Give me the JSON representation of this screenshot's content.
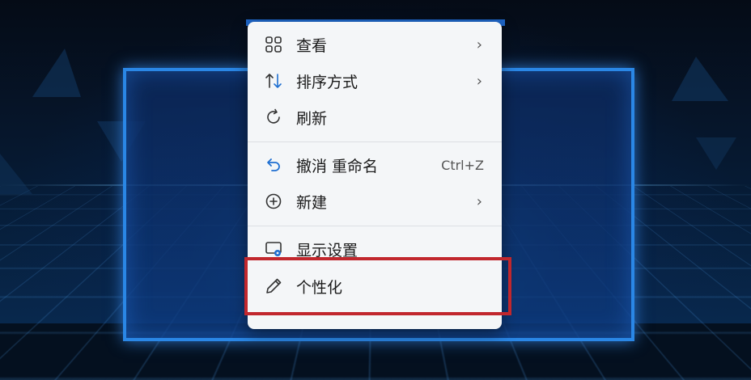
{
  "context_menu": {
    "items": [
      {
        "label": "查看",
        "icon": "grid-view-icon",
        "has_submenu": true
      },
      {
        "label": "排序方式",
        "icon": "sort-icon",
        "has_submenu": true
      },
      {
        "label": "刷新",
        "icon": "refresh-icon",
        "has_submenu": false
      },
      {
        "label": "撤消 重命名",
        "icon": "undo-icon",
        "shortcut": "Ctrl+Z"
      },
      {
        "label": "新建",
        "icon": "add-circle-icon",
        "has_submenu": true
      },
      {
        "label": "显示设置",
        "icon": "display-settings-icon",
        "has_submenu": false
      },
      {
        "label": "个性化",
        "icon": "pen-icon",
        "has_submenu": false
      }
    ],
    "submenu_glyph": "›"
  },
  "highlight_color": "#c1272d",
  "accent_color": "#1f6fd1"
}
